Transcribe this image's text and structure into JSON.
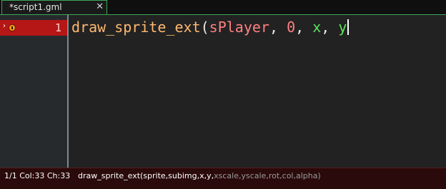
{
  "tab": {
    "label": "*script1.gml",
    "close_glyph": "✕"
  },
  "gutter": {
    "line_number": "1",
    "breakpoint_icon": "breakpoint-error-icon",
    "arrow_glyph": "›"
  },
  "code": {
    "fn": "draw_sprite_ext",
    "open_paren": "(",
    "arg1": "sPlayer",
    "sep1": ", ",
    "arg2": "0",
    "sep2": ", ",
    "arg3": "x",
    "sep3": ", ",
    "arg4": "y"
  },
  "status": {
    "position": "1/1 Col:33 Ch:33",
    "signature_main": "draw_sprite_ext(sprite,subimg,x,y,",
    "signature_optional": "xscale,yscale,rot,col,alpha",
    "signature_close": ")"
  },
  "colors": {
    "accent": "#3aa855",
    "error_line": "#b51616",
    "function": "#ffb871",
    "resource": "#ff8080",
    "variable": "#58e55a"
  }
}
